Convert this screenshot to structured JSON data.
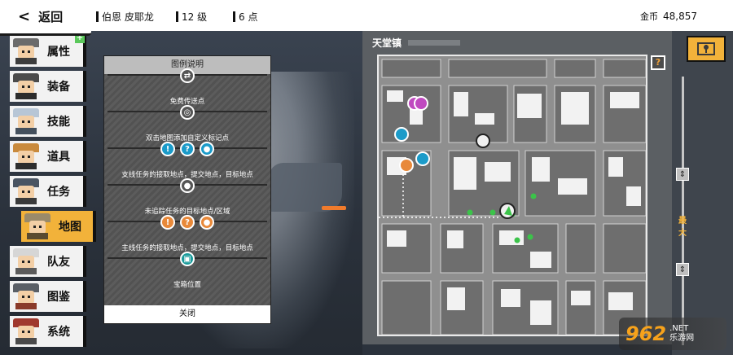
{
  "topbar": {
    "back_label": "返回",
    "player_name": "伯恩 皮耶龙",
    "level": "12 级",
    "points": "6 点",
    "gold_label": "金币",
    "gold_value": "48,857"
  },
  "sidebar": {
    "items": [
      {
        "label": "属性",
        "hair": "#6b6b6b",
        "body": "#3d3d3d"
      },
      {
        "label": "装备",
        "hair": "#4b4b4b",
        "body": "#2c2c2c"
      },
      {
        "label": "技能",
        "hair": "#b7c6d6",
        "body": "#44505d"
      },
      {
        "label": "道具",
        "hair": "#c98a3c",
        "body": "#2d2d2d"
      },
      {
        "label": "任务",
        "hair": "#4a5563",
        "body": "#3a3a3a"
      },
      {
        "label": "地图",
        "hair": "#9a8a6a",
        "body": "#5a4a30"
      },
      {
        "label": "队友",
        "hair": "#d6d6d6",
        "body": "#5b5b5b"
      },
      {
        "label": "图鉴",
        "hair": "#5a5f66",
        "body": "#8a3a2a"
      },
      {
        "label": "系统",
        "hair": "#a0382e",
        "body": "#4a4a4a"
      }
    ]
  },
  "legend": {
    "title": "图例说明",
    "rows": [
      {
        "label": "免费传送点",
        "icons": [
          {
            "name": "fast-travel-icon",
            "color": "#555555",
            "glyph": "⇄"
          }
        ]
      },
      {
        "label": "双击地图添加自定义标记点",
        "icons": [
          {
            "name": "custom-marker-icon",
            "color": "#555555",
            "glyph": "◎"
          }
        ]
      },
      {
        "label": "支线任务的接取地点，提交地点，目标地点",
        "icons": [
          {
            "name": "side-quest-accept-icon",
            "color": "#1b9bc9",
            "glyph": "!"
          },
          {
            "name": "side-quest-submit-icon",
            "color": "#1b9bc9",
            "glyph": "?"
          },
          {
            "name": "side-quest-target-icon",
            "color": "#1b9bc9",
            "glyph": "●"
          }
        ]
      },
      {
        "label": "未追踪任务的目标地点/区域",
        "icons": [
          {
            "name": "untracked-target-icon",
            "color": "#555555",
            "glyph": "●"
          }
        ]
      },
      {
        "label": "主线任务的接取地点，提交地点，目标地点",
        "icons": [
          {
            "name": "main-quest-accept-icon",
            "color": "#e8893a",
            "glyph": "!"
          },
          {
            "name": "main-quest-submit-icon",
            "color": "#e8893a",
            "glyph": "?"
          },
          {
            "name": "main-quest-target-icon",
            "color": "#e8893a",
            "glyph": "●"
          }
        ]
      },
      {
        "label": "宝箱位置",
        "icons": [
          {
            "name": "chest-icon",
            "color": "#1b9b9b",
            "glyph": "▣"
          }
        ]
      }
    ],
    "close_label": "关闭"
  },
  "map": {
    "title": "天堂镇",
    "help_glyph": "?",
    "zoom_label": "最大"
  },
  "watermark": {
    "logo": "962",
    "line1": ".NET",
    "line2": "乐游网"
  }
}
